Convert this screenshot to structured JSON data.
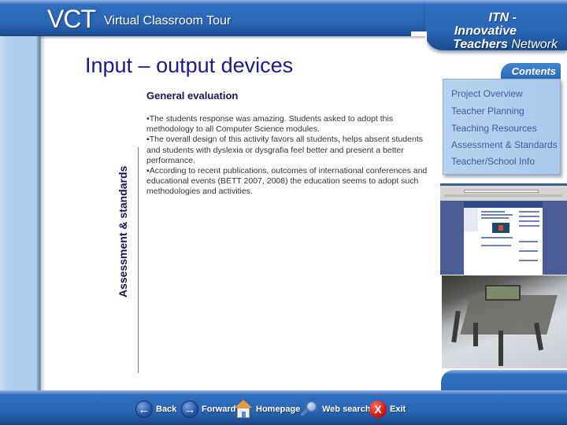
{
  "header": {
    "logo": "VCT",
    "subtitle": "Virtual Classroom Tour",
    "brand_line1": "ITN - Innovative",
    "brand_line2_bold": "Teachers",
    "brand_line2_light": " Network"
  },
  "page": {
    "title": "Input – output devices",
    "section_label": "Assessment & standards",
    "subheading": "General evaluation",
    "bullets": [
      "▪The students response was amazing. Students asked to adopt this methodology to all Computer Science modules.",
      "▪The overall design of this activity favors all students, helps absent students and students with dyslexia or dysgrafia feel better and present a better performance.",
      "▪According to recent publications, outcomes of international conferences and educational events (BETT 2007, 2008) the education seems to adopt such methodologies and activities."
    ]
  },
  "contents": {
    "tab_label": "Contents",
    "items": [
      {
        "label": "Project Overview"
      },
      {
        "label": "Teacher Planning"
      },
      {
        "label": "Teaching  Resources"
      },
      {
        "label": "Assessment & Standards"
      },
      {
        "label": "Teacher/School Info"
      }
    ]
  },
  "images": {
    "screenshot": "website-screenshot",
    "photo": "robot-photo"
  },
  "nav": {
    "back": "Back",
    "forward": "Forward",
    "homepage": "Homepage",
    "web_search": "Web search",
    "exit": "Exit"
  },
  "colors": {
    "brand_blue": "#2a66b5",
    "title_navy": "#1a1a8c",
    "contents_panel": "#b0cfee",
    "contents_link": "#3b5f99"
  }
}
